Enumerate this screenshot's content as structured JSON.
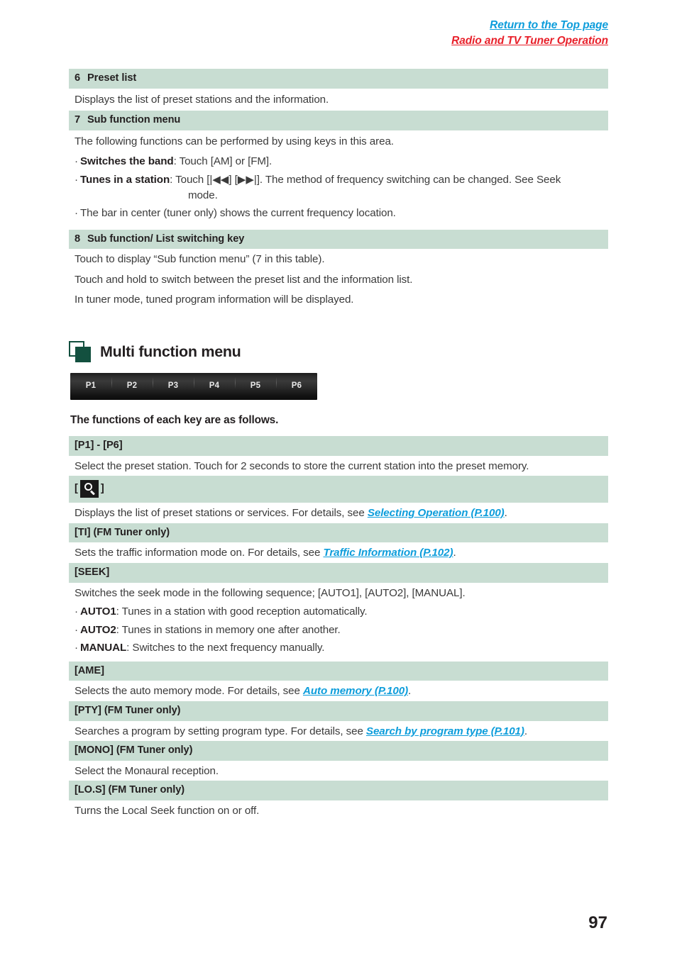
{
  "topnav": {
    "return_top": "Return to the Top page",
    "section": "Radio and TV Tuner Operation"
  },
  "sections": [
    {
      "num": "6",
      "title": "Preset list",
      "lines": [
        "Displays the list of preset stations and the information."
      ]
    },
    {
      "num": "7",
      "title": "Sub function menu",
      "intro": "The following functions can be performed by using keys in this area.",
      "bullets": [
        {
          "bold": "Switches the band",
          "rest": ": Touch [AM] or [FM]."
        },
        {
          "bold": "Tunes in a station",
          "rest": ": Touch [|◀◀] [▶▶|]. The method of frequency switching can be changed. See Seek",
          "cont": "mode."
        },
        {
          "bold": "",
          "rest": "The bar in center (tuner only) shows the current frequency location."
        }
      ]
    },
    {
      "num": "8",
      "title": "Sub function/ List switching key",
      "lines": [
        "Touch to display “Sub function menu” (7 in this table).",
        "Touch and hold to switch between the preset list and the information list.",
        "In tuner mode, tuned program information will be displayed."
      ]
    }
  ],
  "mfm": {
    "title": "Multi function menu",
    "preset_keys": [
      "P1",
      "P2",
      "P3",
      "P4",
      "P5",
      "P6"
    ],
    "subhead": "The functions of each key are as follows."
  },
  "key_table": [
    {
      "key": "[P1] - [P6]",
      "icon": null,
      "text_before": "Select the preset station. Touch for 2 seconds to store the current station into the preset memory.",
      "link": null,
      "text_after": ""
    },
    {
      "key": "",
      "icon": "search-icon",
      "bracket_open": "[",
      "bracket_close": "]",
      "text_before": "Displays the list of preset stations or services. For details, see ",
      "link": "Selecting Operation (P.100)",
      "text_after": "."
    },
    {
      "key": "[TI] (FM Tuner only)",
      "icon": null,
      "text_before": "Sets the traffic information mode on. For details, see ",
      "link": "Traffic Information (P.102)",
      "text_after": "."
    },
    {
      "key": "[SEEK]",
      "icon": null,
      "text_before": "Switches the seek mode in the following sequence; [AUTO1], [AUTO2], [MANUAL].",
      "link": null,
      "text_after": "",
      "bullets": [
        {
          "bold": "AUTO1",
          "rest": ": Tunes in a station with good reception automatically."
        },
        {
          "bold": "AUTO2",
          "rest": ": Tunes in stations in memory one after another."
        },
        {
          "bold": "MANUAL",
          "rest": ": Switches to the next frequency manually."
        }
      ]
    },
    {
      "key": "[AME]",
      "icon": null,
      "text_before": "Selects the auto memory mode. For details, see ",
      "link": "Auto memory (P.100)",
      "text_after": "."
    },
    {
      "key": "[PTY] (FM Tuner only)",
      "icon": null,
      "text_before": "Searches a program by setting program type. For details, see ",
      "link": "Search by program type (P.101)",
      "text_after": "."
    },
    {
      "key": "[MONO] (FM Tuner only)",
      "icon": null,
      "text_before": "Select the Monaural reception.",
      "link": null,
      "text_after": ""
    },
    {
      "key": "[LO.S] (FM Tuner only)",
      "icon": null,
      "text_before": "Turns the Local Seek function on or off.",
      "link": null,
      "text_after": ""
    }
  ],
  "colors": {
    "header_green": "#c8ddd2",
    "link_blue": "#0d9ddb",
    "link_red": "#e8202a",
    "icon_green": "#13503f"
  },
  "page_number": "97"
}
